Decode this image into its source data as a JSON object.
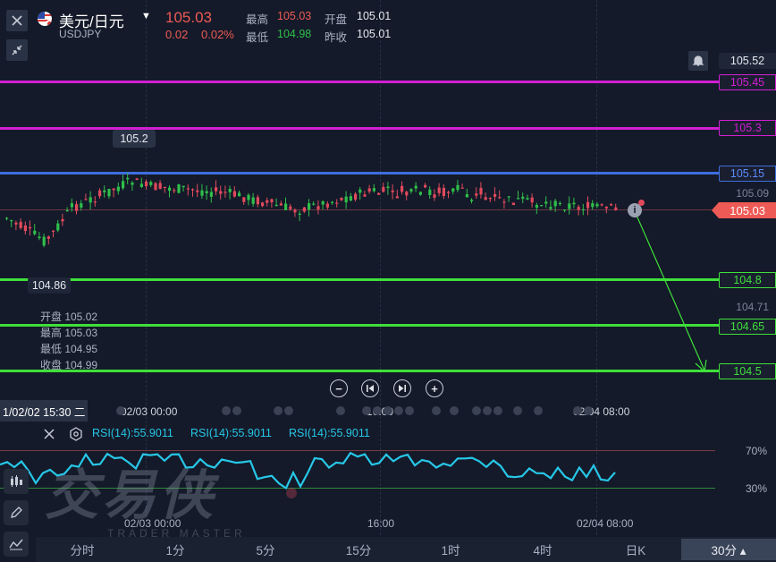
{
  "header": {
    "pair_name": "美元/日元",
    "symbol": "USDJPY",
    "last_price": "105.03",
    "change": "0.02",
    "change_pct": "0.02%",
    "high_label": "最高",
    "high_value": "105.03",
    "low_label": "最低",
    "low_value": "104.98",
    "open_label": "开盘",
    "open_value": "105.01",
    "prev_close_label": "昨收",
    "prev_close_value": "105.01"
  },
  "price_axis": {
    "top_value": "105.52",
    "level_105_45": "105.45",
    "level_105_3": "105.3",
    "level_105_15": "105.15",
    "tick_105_09": "105.09",
    "current": "105.03",
    "level_104_8": "104.8",
    "tick_104_71": "104.71",
    "level_104_65": "104.65",
    "level_104_5": "104.5"
  },
  "chart_labels": {
    "high_marker": "105.2",
    "low_marker": "104.86"
  },
  "ohlc_panel": {
    "open": "开盘 105.02",
    "high": "最高 105.03",
    "low": "最低 104.95",
    "close": "收盘 104.99"
  },
  "time_axis": {
    "crosshair_time": "1/02/02 15:30 二",
    "t1": "02/03 00:00",
    "t2": "16:00",
    "t3": "02/04 08:00"
  },
  "rsi": {
    "label1": "RSI(14):55.9011",
    "label2": "RSI(14):55.9011",
    "label3": "RSI(14):55.9011",
    "level_70": "70%",
    "level_30": "30%",
    "t1": "02/03 00:00",
    "t2": "16:00",
    "t3": "02/04 08:00"
  },
  "watermark": {
    "brand": "交易侠",
    "sub": "TRADER MASTER"
  },
  "tabs": [
    {
      "label": "分时"
    },
    {
      "label": "1分"
    },
    {
      "label": "5分"
    },
    {
      "label": "15分"
    },
    {
      "label": "1时"
    },
    {
      "label": "4时"
    },
    {
      "label": "日K"
    },
    {
      "label": "30分 ▴"
    }
  ],
  "colors": {
    "up": "#e14a5c",
    "down": "#2fbf4a",
    "magenta": "#d21fd2",
    "blue": "#3f6fe0",
    "green_line": "#3ee03a",
    "rsi": "#27c7e8",
    "current_tag": "#ee5a55"
  },
  "icons": {
    "close": "close-icon",
    "collapse": "collapse-arrows-icon",
    "bell": "bell-icon",
    "zoom_out": "minus-circle-icon",
    "first": "skip-first-icon",
    "last": "skip-last-icon",
    "zoom_in": "plus-circle-icon"
  }
}
